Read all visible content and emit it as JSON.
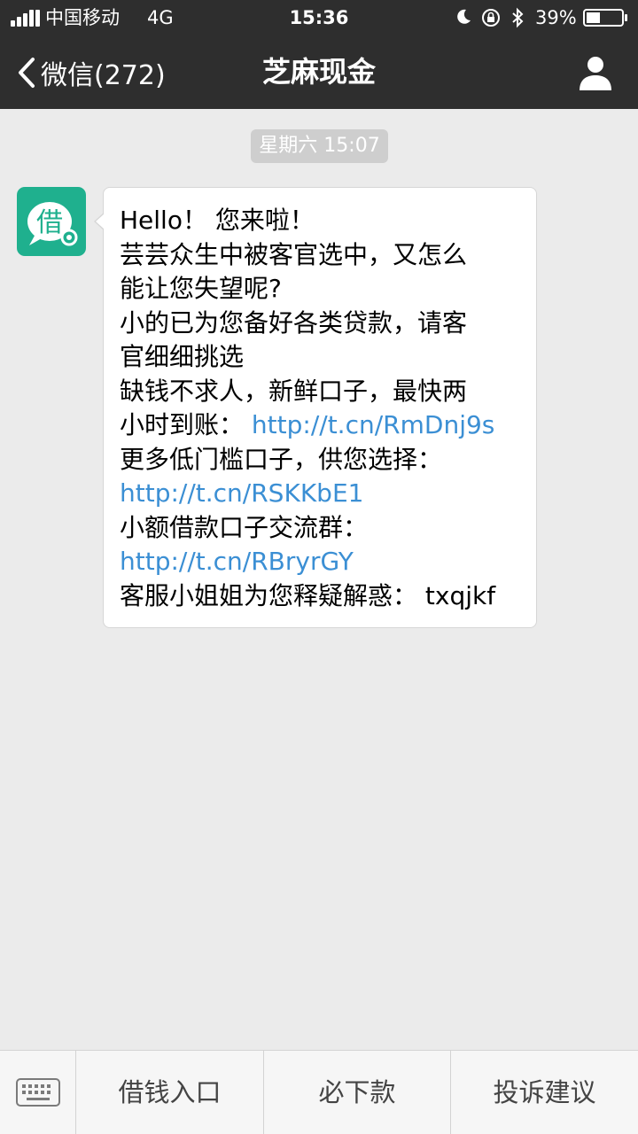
{
  "status_bar": {
    "carrier": "中国移动",
    "network": "4G",
    "time": "15:36",
    "battery_percent": "39%",
    "battery_level": 0.39,
    "icons": [
      "signal-icon",
      "moon-icon",
      "orientation-lock-icon",
      "bluetooth-icon",
      "battery-icon"
    ]
  },
  "nav": {
    "back_label": "微信(272)",
    "title": "芝麻现金",
    "profile_icon": "person-icon"
  },
  "chat": {
    "timestamp": "星期六 15:07",
    "avatar_char": "借",
    "message": {
      "lines": [
        "Hello！ 您来啦！",
        "芸芸众生中被客官选中，又怎么",
        "能让您失望呢?",
        "小的已为您备好各类贷款，请客",
        "官细细挑选",
        "缺钱不求人，新鲜口子，最快两",
        "小时到账：",
        "更多低门槛口子，供您选择：",
        "小额借款口子交流群：",
        "客服小姐姐为您释疑解惑： txqjkf"
      ],
      "links": [
        "http://t.cn/RmDnj9s",
        "http://t.cn/RSKKbE1",
        "http://t.cn/RBryrGY"
      ]
    }
  },
  "bottom_menu": {
    "keyboard_icon": "keyboard-icon",
    "items": [
      "借钱入口",
      "必下款",
      "投诉建议"
    ]
  },
  "colors": {
    "nav_bg": "#2e2e2e",
    "chat_bg": "#ebebeb",
    "link": "#3b8fd4",
    "avatar_green": "#1fb08e"
  }
}
